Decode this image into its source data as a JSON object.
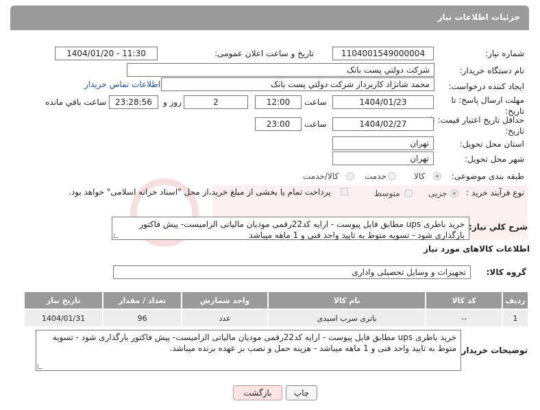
{
  "header": {
    "title": "جزئیات اطلاعات نیاز"
  },
  "fields": {
    "need_number_label": "شماره نیاز:",
    "need_number": "1104001549000004",
    "announce_label": "تاریخ و ساعت اعلان عمومی:",
    "announce_value": "1404/01/20 - 11:30",
    "buyer_org_label": "نام دستگاه خریدار:",
    "buyer_org": "شرکت دولتي پست بانک",
    "creator_label": "ایجاد کننده درخواست:",
    "creator": "محمد شانژاد کاربرداز شرکت دولتي پست بانک",
    "buyer_contact_link": "اطلاعات تماس خریدار",
    "deadline_label": "مهلت ارسال پاسخ: تا تاریخ:",
    "deadline_date": "1404/01/23",
    "time_label": "ساعت",
    "deadline_time": "12:00",
    "days_value": "2",
    "days_label": "روز و",
    "remaining_time": "23:28:56",
    "remaining_label": "ساعت باقي مانده",
    "min_validity_label": "حداقل تاریخ اعتبار قیمت: تا تاریخ:",
    "validity_date": "1404/02/27",
    "validity_time": "23:00",
    "province_label": "استان محل تحویل:",
    "province": "تهران",
    "city_label": "شهر محل تحویل:",
    "city": "تهران",
    "category_label": "طبقه بندی موضوعی:",
    "category_options": [
      "کالا",
      "خدمت",
      "کالا/خدمت"
    ],
    "purchase_type_label": "نوع فرآیند خرید :",
    "purchase_options": [
      "جزیی",
      "متوسط"
    ],
    "payment_note": "پرداخت تمام یا بخشی از مبلغ خرید،از محل \"اسناد خزانه اسلامی\" خواهد بود."
  },
  "description": {
    "label": "شرح کلي نیاز:",
    "text": "خرید باطری ups مطابق فایل پیوست - ارایه کد22رقمی مودیان مالیاتی الزامیست- پیش فاکتور بارگذاری شود - تسویه متوط به تایید واحد فنی و 1 ماهه میباشد"
  },
  "goods_info_title": "اطلاعات کالاهای مورد نیاز",
  "goods_group": {
    "label": "گروه کالا:",
    "value": "تجهیزات و وسایل تحصیلی واداری"
  },
  "table": {
    "headers": [
      "ردیف",
      "کد کالا",
      "نام کالا",
      "واحد شمارش",
      "تعداد / مقدار",
      "تاریخ نیاز"
    ],
    "rows": [
      {
        "row": "1",
        "code": "--",
        "name": "باتری سرب اسیدی",
        "unit": "عدد",
        "qty": "96",
        "date": "1404/01/31"
      }
    ]
  },
  "buyer_notes": {
    "label": "توضیحات خریدار:",
    "text": "خرید باطری ups مطابق فایل پیوست - ارایه کد22رقمی مودیان مالیاتی الزامیست- پیش فاکتور بارگذاری شود - تسویه متوط به تایید واحد فنی و 1 ماهه میباشد - هزینه حمل و نصب بر عهده برنده میباشد."
  },
  "buttons": {
    "print": "چاپ",
    "back": "بازگشت"
  },
  "colors": {
    "header_bg": "#9a9a9a",
    "link": "#1a4fa0",
    "back_button_bg": "#fde4e4"
  }
}
